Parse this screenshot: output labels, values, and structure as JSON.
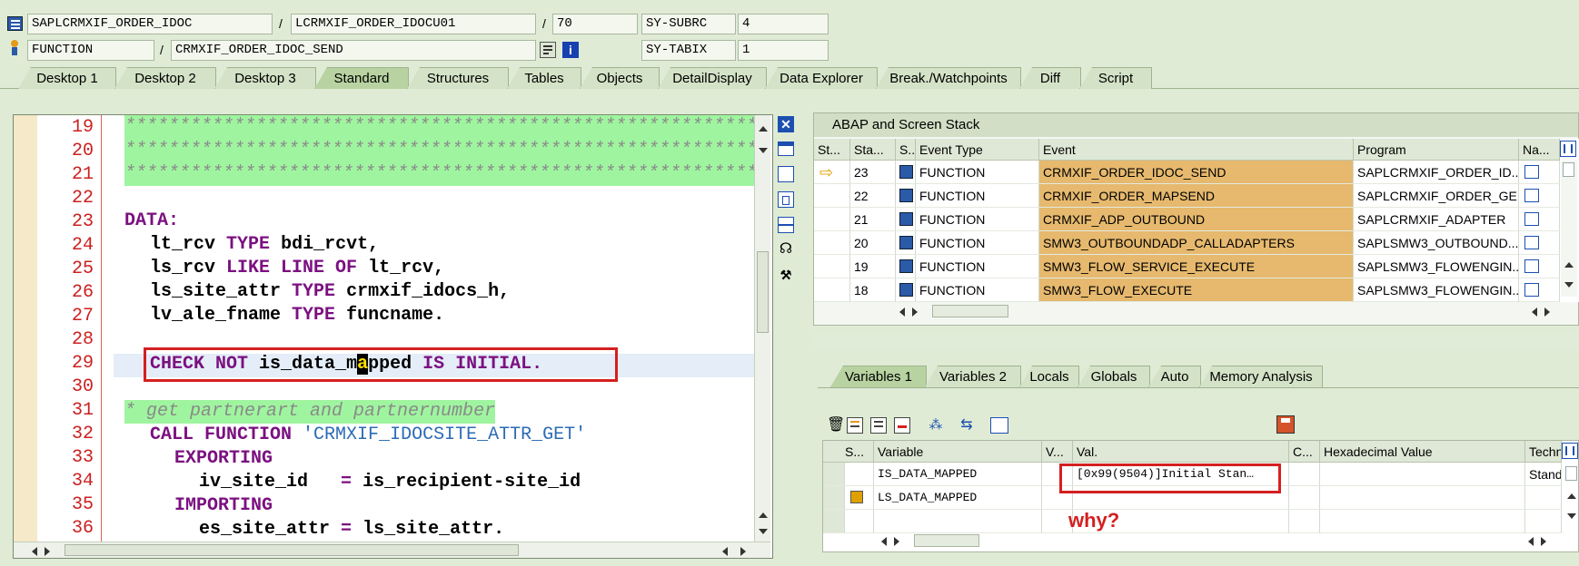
{
  "header": {
    "program": "SAPLCRMXIF_ORDER_IDOC",
    "include": "LCRMXIF_ORDER_IDOCU01",
    "line": "70",
    "subrc_label": "SY-SUBRC",
    "subrc_value": "4",
    "event_type": "FUNCTION",
    "event": "CRMXIF_ORDER_IDOC_SEND",
    "tabix_label": "SY-TABIX",
    "tabix_value": "1",
    "sep": "/"
  },
  "tabs": [
    "Desktop 1",
    "Desktop 2",
    "Desktop 3",
    "Standard",
    "Structures",
    "Tables",
    "Objects",
    "DetailDisplay",
    "Data Explorer",
    "Break./Watchpoints",
    "Diff",
    "Script"
  ],
  "active_tab": "Standard",
  "editor": {
    "line_numbers": [
      "19",
      "20",
      "21",
      "22",
      "23",
      "24",
      "25",
      "26",
      "27",
      "28",
      "29",
      "30",
      "31",
      "32",
      "33",
      "34",
      "35",
      "36"
    ],
    "stars": "*************************************************************",
    "data_kw": "DATA:",
    "l24": {
      "a": "lt_rcv",
      "b": "TYPE",
      "c": "bdi_rcvt,"
    },
    "l25": {
      "a": "ls_rcv",
      "b": "LIKE LINE OF",
      "c": "lt_rcv,"
    },
    "l26": {
      "a": "ls_site_attr",
      "b": "TYPE",
      "c": "crmxif_idocs_h,"
    },
    "l27": {
      "a": "lv_ale_fname",
      "b": "TYPE",
      "c": "funcname."
    },
    "l29": {
      "a": "CHECK NOT",
      "b": "is_data_m",
      "cursor": "a",
      "c": "pped",
      "d": "IS INITIAL."
    },
    "l31": "* get partnerart and partnernumber",
    "l32": {
      "a": "CALL FUNCTION",
      "b": "'CRMXIF_IDOCSITE_ATTR_GET'"
    },
    "l33": "EXPORTING",
    "l34": {
      "a": "iv_site_id",
      "b": "=",
      "c": "is_recipient-site_id"
    },
    "l35": "IMPORTING",
    "l36": {
      "a": "es_site_attr",
      "b": "=",
      "c": "ls_site_attr."
    }
  },
  "stack": {
    "title": "ABAP and Screen Stack",
    "columns": [
      "St...",
      "Sta...",
      "S..",
      "Event Type",
      "Event",
      "Program",
      "Na..."
    ],
    "rows": [
      {
        "level": "23",
        "type": "FUNCTION",
        "event": "CRMXIF_ORDER_IDOC_SEND",
        "program": "SAPLCRMXIF_ORDER_ID...",
        "current": true
      },
      {
        "level": "22",
        "type": "FUNCTION",
        "event": "CRMXIF_ORDER_MAPSEND",
        "program": "SAPLCRMXIF_ORDER_GEN",
        "current": false
      },
      {
        "level": "21",
        "type": "FUNCTION",
        "event": "CRMXIF_ADP_OUTBOUND",
        "program": "SAPLCRMXIF_ADAPTER",
        "current": false
      },
      {
        "level": "20",
        "type": "FUNCTION",
        "event": "SMW3_OUTBOUNDADP_CALLADAPTERS",
        "program": "SAPLSMW3_OUTBOUND...",
        "current": false
      },
      {
        "level": "19",
        "type": "FUNCTION",
        "event": "SMW3_FLOW_SERVICE_EXECUTE",
        "program": "SAPLSMW3_FLOWENGIN...",
        "current": false
      },
      {
        "level": "18",
        "type": "FUNCTION",
        "event": "SMW3_FLOW_EXECUTE",
        "program": "SAPLSMW3_FLOWENGIN...",
        "current": false
      }
    ]
  },
  "var_tabs": [
    "Variables 1",
    "Variables 2",
    "Locals",
    "Globals",
    "Auto",
    "Memory Analysis"
  ],
  "active_var_tab": "Variables 1",
  "variables": {
    "columns": [
      "S...",
      "Variable",
      "V...",
      "Val.",
      "C...",
      "Hexadecimal Value",
      "Techn"
    ],
    "rows": [
      {
        "name": "IS_DATA_MAPPED",
        "value": "[0x99(9504)]Initial Stan…",
        "tech": "Standa"
      },
      {
        "name": "LS_DATA_MAPPED",
        "value": "",
        "tech": ""
      },
      {
        "name": "",
        "value": "",
        "tech": ""
      }
    ]
  },
  "annotation": "why?"
}
